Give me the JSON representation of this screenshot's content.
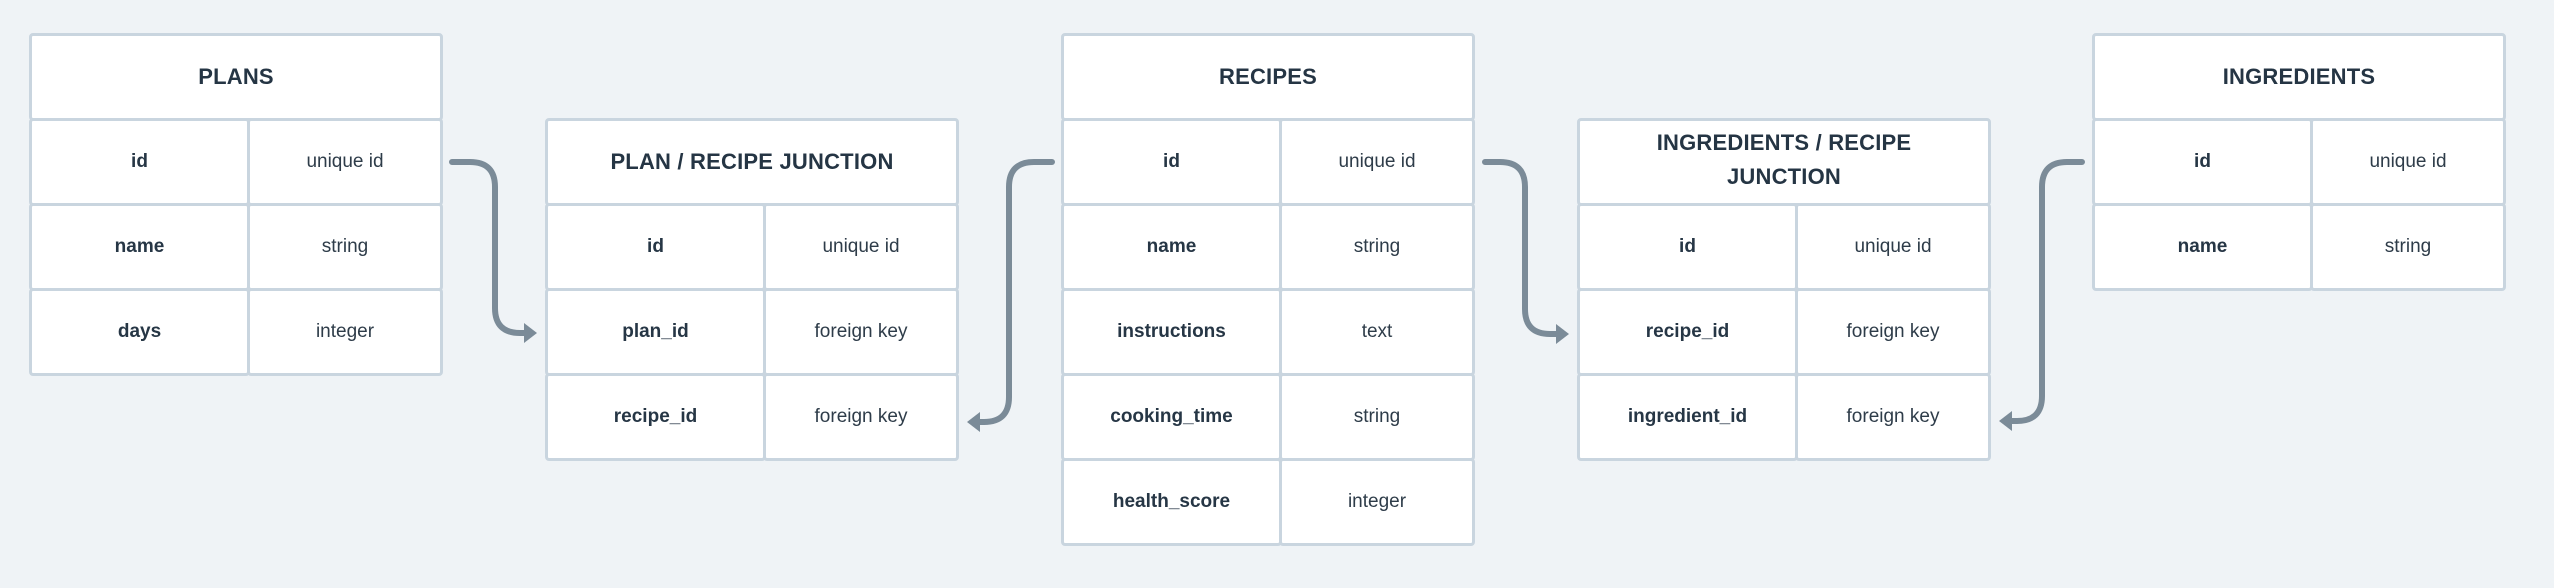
{
  "diagram": {
    "tables": [
      {
        "id": "plans",
        "title": "PLANS",
        "rows": [
          {
            "field": "id",
            "type": "unique id"
          },
          {
            "field": "name",
            "type": "string"
          },
          {
            "field": "days",
            "type": "integer"
          }
        ]
      },
      {
        "id": "plan-recipe-junction",
        "title": "PLAN / RECIPE JUNCTION",
        "rows": [
          {
            "field": "id",
            "type": "unique id"
          },
          {
            "field": "plan_id",
            "type": "foreign key"
          },
          {
            "field": "recipe_id",
            "type": "foreign key"
          }
        ]
      },
      {
        "id": "recipes",
        "title": "RECIPES",
        "rows": [
          {
            "field": "id",
            "type": "unique id"
          },
          {
            "field": "name",
            "type": "string"
          },
          {
            "field": "instructions",
            "type": "text"
          },
          {
            "field": "cooking_time",
            "type": "string"
          },
          {
            "field": "health_score",
            "type": "integer"
          }
        ]
      },
      {
        "id": "ingredients-recipe-junction",
        "title": "INGREDIENTS / RECIPE JUNCTION",
        "rows": [
          {
            "field": "id",
            "type": "unique id"
          },
          {
            "field": "recipe_id",
            "type": "foreign key"
          },
          {
            "field": "ingredient_id",
            "type": "foreign key"
          }
        ]
      },
      {
        "id": "ingredients",
        "title": "INGREDIENTS",
        "rows": [
          {
            "field": "id",
            "type": "unique id"
          },
          {
            "field": "name",
            "type": "string"
          }
        ]
      }
    ],
    "relationships": [
      {
        "from": "plans.id",
        "to": "plan-recipe-junction.plan_id"
      },
      {
        "from": "recipes.id",
        "to": "plan-recipe-junction.recipe_id"
      },
      {
        "from": "recipes.id",
        "to": "ingredients-recipe-junction.recipe_id"
      },
      {
        "from": "ingredients.id",
        "to": "ingredients-recipe-junction.ingredient_id"
      }
    ],
    "colors": {
      "background": "#eff3f6",
      "cell_background": "#ffffff",
      "cell_border": "#c9d5df",
      "text": "#263645",
      "connector": "#7b8b98"
    }
  }
}
